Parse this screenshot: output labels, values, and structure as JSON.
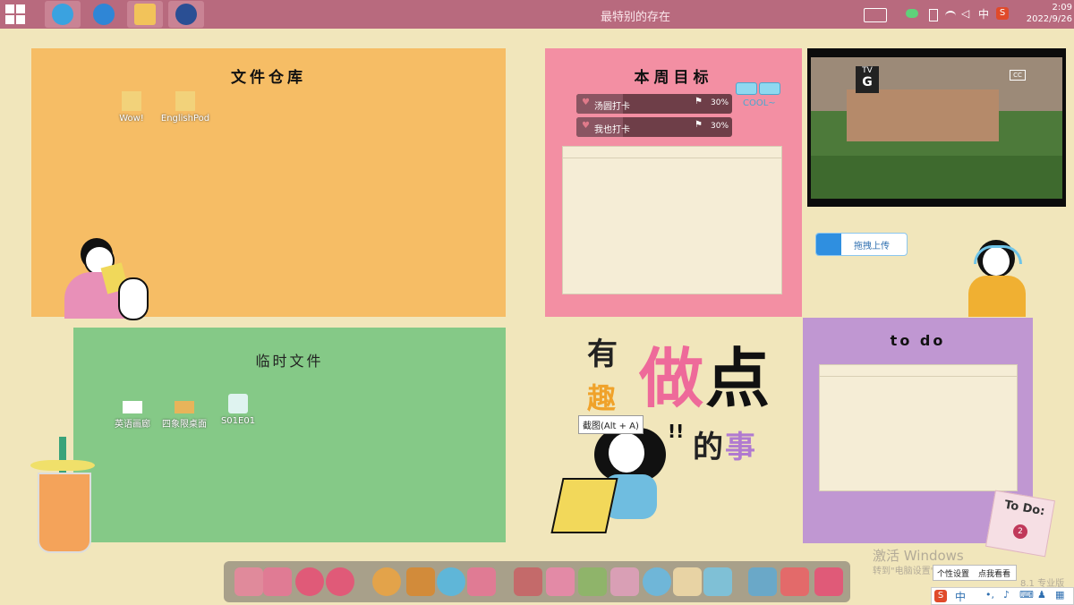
{
  "taskbar": {
    "window_title": "最特别的存在",
    "input_lang": "中",
    "clock_time": "2:09",
    "clock_date": "2022/9/26",
    "pinned": [
      {
        "name": "ie-icon",
        "color": "#3aa2e0"
      },
      {
        "name": "ie-icon-2",
        "color": "#2f86d6"
      },
      {
        "name": "file-explorer-icon",
        "color": "#f2c35a"
      },
      {
        "name": "media-player-icon",
        "color": "#2a4f94"
      }
    ]
  },
  "panels": {
    "files": {
      "title": "文件仓库",
      "color": "#f6bd65",
      "icons": [
        {
          "label": "Wow!"
        },
        {
          "label": "EnglishPod"
        }
      ]
    },
    "temp": {
      "title": "临时文件",
      "color": "#85c987",
      "icons": [
        {
          "label": "英语画廊"
        },
        {
          "label": "四象限桌面"
        },
        {
          "label": "S01E01"
        }
      ]
    },
    "weekly": {
      "title": "本周目标",
      "color": "#f38fa3",
      "goals": [
        {
          "label": "汤圆打卡",
          "percent_text": "30%",
          "progress": 0.3
        },
        {
          "label": "我也打卡",
          "percent_text": "30%",
          "progress": 0.3
        }
      ]
    },
    "todo": {
      "title": "to do",
      "color": "#c097d2"
    }
  },
  "video": {
    "rating_top": "TV",
    "rating_bottom": "G",
    "cc": "CC"
  },
  "upload_button": "拖拽上传",
  "slogan": {
    "w1": "有",
    "w2": "趣",
    "w3": "做",
    "w4": "点",
    "w5": "的",
    "w6": "事"
  },
  "tooltip": "截图(Alt + A)",
  "cool_text": "COOL~",
  "todo_sticker": {
    "text": "To Do:",
    "badge": "2"
  },
  "activation": {
    "title": "激活 Windows",
    "subtitle": "转到\"电脑设置\"以激活 Windows。",
    "edition": "8.1 专业版"
  },
  "popup_buttons": {
    "personalize": "个性设置",
    "take_a_look": "点我看看"
  },
  "input_bar": {
    "lang": "中"
  },
  "dock_items": [
    {
      "name": "notes-icon",
      "color": "#e08a9b"
    },
    {
      "name": "app-store-icon",
      "color": "#e07b94"
    },
    {
      "name": "camera-icon",
      "color": "#e05a78"
    },
    {
      "name": "settings-icon",
      "color": "#e05a78"
    },
    {
      "name": "compass-icon",
      "color": "#e3a34a"
    },
    {
      "name": "film-icon",
      "color": "#d28b3a"
    },
    {
      "name": "chat-icon",
      "color": "#5fb6d8"
    },
    {
      "name": "cards-icon",
      "color": "#e07b94"
    },
    {
      "name": "bookshelf-icon",
      "color": "#c46a6a"
    },
    {
      "name": "mail-icon",
      "color": "#e38aa6"
    },
    {
      "name": "microphone-icon",
      "color": "#8fb46a"
    },
    {
      "name": "dictionary-icon",
      "color": "#d99fb5"
    },
    {
      "name": "lightbulb-icon",
      "color": "#6fb6d8"
    },
    {
      "name": "todo-list-icon",
      "color": "#e8d3a4"
    },
    {
      "name": "calendar-icon",
      "color": "#7fc0d6"
    },
    {
      "name": "record-player-icon",
      "color": "#6aa8c8"
    },
    {
      "name": "popcorn-icon",
      "color": "#e36a6a"
    },
    {
      "name": "trash-icon",
      "color": "#e05a78"
    }
  ]
}
